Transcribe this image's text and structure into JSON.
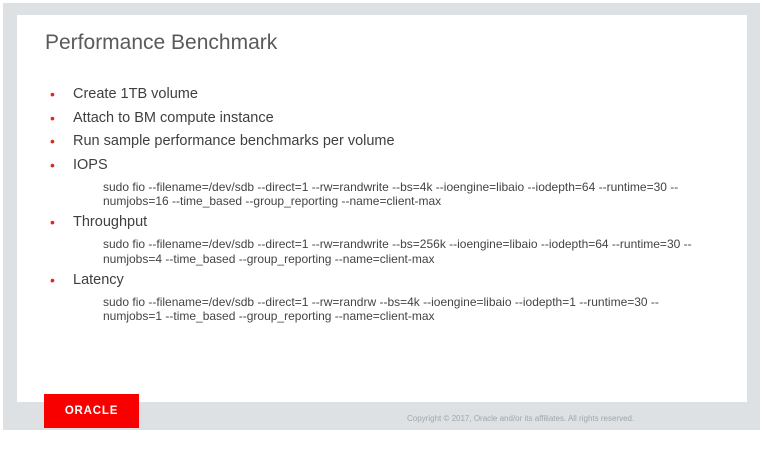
{
  "slide": {
    "title": "Performance Benchmark",
    "bullets": [
      {
        "text": "Create 1TB volume"
      },
      {
        "text": "Attach to BM compute instance"
      },
      {
        "text": "Run sample performance benchmarks per volume"
      },
      {
        "text": "IOPS",
        "code": "sudo fio --filename=/dev/sdb --direct=1 --rw=randwrite --bs=4k --ioengine=libaio --iodepth=64 --runtime=30 --numjobs=16 --time_based --group_reporting --name=client-max"
      },
      {
        "text": "Throughput",
        "code": "sudo fio --filename=/dev/sdb --direct=1 --rw=randwrite --bs=256k --ioengine=libaio --iodepth=64 --runtime=30 --numjobs=4 --time_based --group_reporting --name=client-max"
      },
      {
        "text": "Latency",
        "code": "sudo fio --filename=/dev/sdb --direct=1 --rw=randrw --bs=4k --ioengine=libaio --iodepth=1 --runtime=30 --numjobs=1 --time_based --group_reporting --name=client-max"
      }
    ],
    "bullet_symbol": "•"
  },
  "footer": {
    "logo_text": "ORACLE",
    "copyright": "Copyright © 2017, Oracle and/or its affiliates. All rights reserved."
  },
  "colors": {
    "accent_red": "#f80000",
    "bullet_red": "#d62b1e",
    "frame_gray": "#dde1e4"
  }
}
